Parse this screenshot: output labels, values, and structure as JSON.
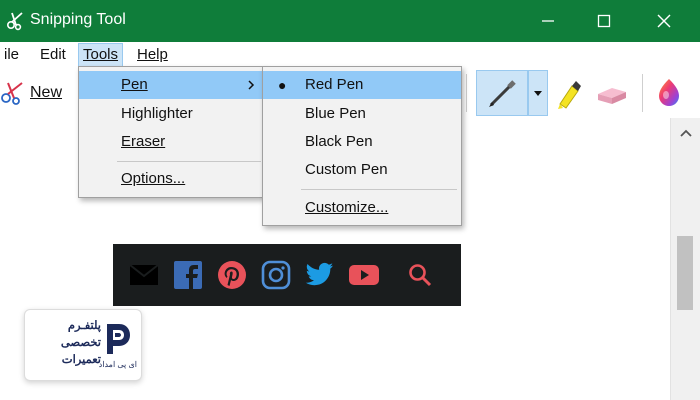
{
  "window": {
    "title": "Snipping Tool",
    "controls": {
      "minimize": "—",
      "maximize": "☐",
      "close": "✕"
    }
  },
  "menubar": {
    "items": [
      {
        "label": "ile",
        "underline": ""
      },
      {
        "label": "Edit",
        "underline": ""
      },
      {
        "label": "Tools",
        "underline": "T"
      },
      {
        "label": "Help",
        "underline": "H"
      }
    ]
  },
  "toolbar": {
    "new_label": "New",
    "new_underline": "N",
    "pen_tool": "pen-icon",
    "highlighter_tool": "highlighter-icon",
    "eraser_tool": "eraser-icon",
    "paint3d_tool": "paint3d-icon"
  },
  "tools_menu": {
    "items": [
      {
        "label": "Pen",
        "highlighted": true,
        "submenu": true
      },
      {
        "label": "Highlighter",
        "highlighted": false,
        "submenu": false
      },
      {
        "label": "Eraser",
        "highlighted": false,
        "submenu": false
      },
      {
        "label": "Options...",
        "highlighted": false,
        "submenu": false
      }
    ],
    "submenu_arrow": "›"
  },
  "pen_menu": {
    "items": [
      {
        "label": "Red Pen",
        "checked": true
      },
      {
        "label": "Blue Pen",
        "checked": false
      },
      {
        "label": "Black Pen",
        "checked": false
      },
      {
        "label": "Custom Pen",
        "checked": false
      },
      {
        "label": "Customize...",
        "checked": false
      }
    ],
    "bullet": "●"
  },
  "capture": {
    "icons": [
      "email-icon",
      "facebook-icon",
      "pinterest-icon",
      "instagram-icon",
      "twitter-icon",
      "youtube-icon",
      "search-icon"
    ]
  },
  "logo": {
    "line1": "پلتفـرم",
    "line2": "تخصصی",
    "line3": "تعمیرات",
    "sub": "ای پی امداد"
  },
  "colors": {
    "titlebar": "#0f7d3a",
    "menu_highlight": "#91c9f7",
    "pen_tool_bg": "#cce4f7",
    "capture_bg": "#1a1d1e",
    "social_red": "#e8525a",
    "social_blue": "#1c9be3"
  }
}
